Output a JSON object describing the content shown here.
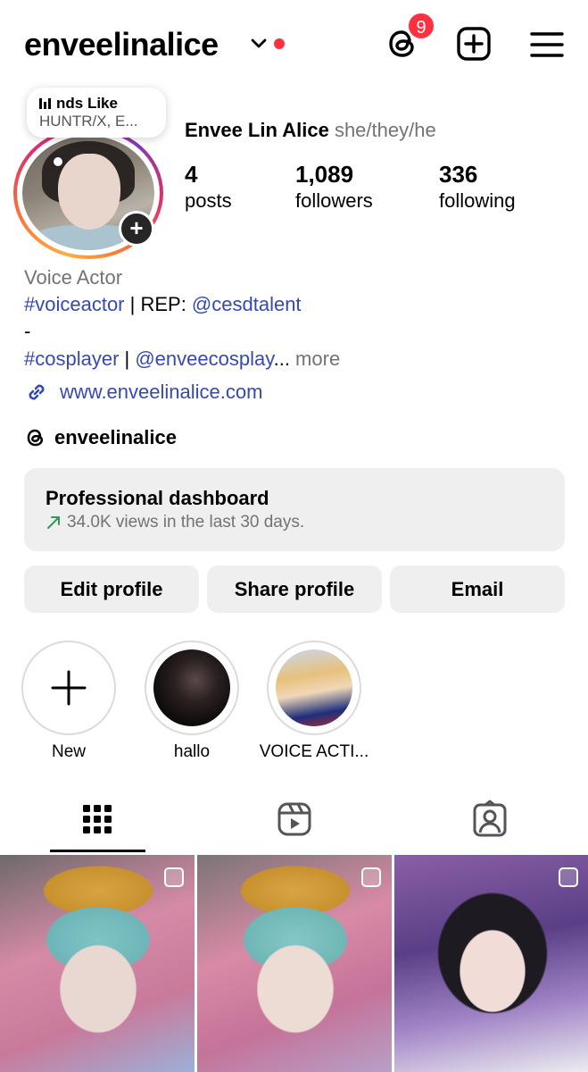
{
  "header": {
    "username": "enveelinalice",
    "notification_count": "9",
    "icons": [
      "chevron-down-icon",
      "threads-icon",
      "create-post-icon",
      "menu-icon"
    ],
    "accent_red": "#ff3040"
  },
  "note": {
    "title": "nds Like",
    "subtitle": "HUNTR/X, E..."
  },
  "profile": {
    "full_name": "Envee Lin Alice",
    "pronouns": "she/they/he",
    "stats": [
      {
        "num": "4",
        "label": "posts"
      },
      {
        "num": "1,089",
        "label": "followers"
      },
      {
        "num": "336",
        "label": "following"
      }
    ]
  },
  "bio": {
    "category": "Voice Actor",
    "line1_tag": "#voiceactor",
    "line1_text": " | REP: ",
    "line1_mention": "@cesdtalent",
    "line2": "-",
    "line3_tag": "#cosplayer",
    "line3_sep": " | ",
    "line3_mention": "@enveecosplay",
    "line3_ellipsis": "...",
    "more": " more",
    "website": "www.enveelinalice.com",
    "threads_handle": "enveelinalice",
    "link_color": "#3649b0"
  },
  "dashboard": {
    "title": "Professional dashboard",
    "subtitle": "34.0K views in the last 30 days."
  },
  "buttons": {
    "edit": "Edit profile",
    "share": "Share profile",
    "email": "Email"
  },
  "highlights": [
    {
      "label": "New"
    },
    {
      "label": "hallo"
    },
    {
      "label": "VOICE ACTI..."
    }
  ],
  "tabs": [
    "grid-icon",
    "reels-icon",
    "tagged-icon"
  ]
}
